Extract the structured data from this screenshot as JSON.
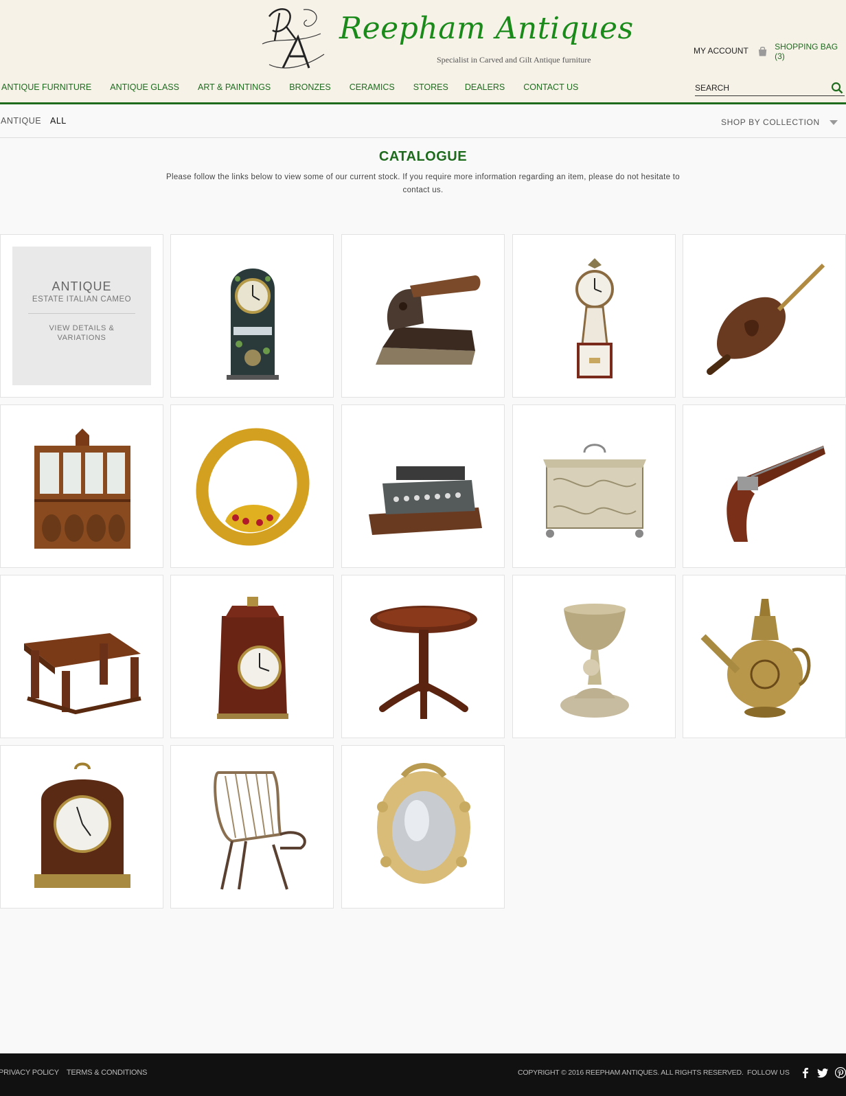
{
  "header": {
    "logo_title": "Reepham Antiques",
    "logo_tagline": "Specialist in Carved and Gilt Antique furniture",
    "my_account": "MY ACCOUNT",
    "shopping_bag": "SHOPPING BAG (3)",
    "nav": [
      "ANTIQUE FURNITURE",
      "ANTIQUE GLASS",
      "ART & PAINTINGS",
      "BRONZES",
      "CERAMICS",
      "STORES",
      "DEALERS",
      "CONTACT US"
    ],
    "search_placeholder": "SEARCH"
  },
  "subbar": {
    "breadcrumb": "ANTIQUE",
    "filter_all": "ALL",
    "shop_by_collection": "SHOP BY COLLECTION"
  },
  "catalogue": {
    "title": "CATALOGUE",
    "description": "Please follow the links below to view some of our current stock. If you require more information regarding an item, please do not hesitate to contact us."
  },
  "featured": {
    "title": "ANTIQUE",
    "subtitle": "ESTATE ITALIAN CAMEO",
    "link": "VIEW DETAILS & VARIATIONS"
  },
  "products": [
    "mantel-clock",
    "carved-iron",
    "banjo-clock",
    "carved-bellows",
    "breakfront-bookcase",
    "gold-bangle",
    "typewriter",
    "silver-tea-caddy",
    "flintlock-pistol",
    "carved-table",
    "bracket-clock",
    "tilt-top-table",
    "silver-cherub-chalice",
    "brass-ewer",
    "mahogany-bracket-clock",
    "rattan-chair",
    "gilt-oval-mirror"
  ],
  "footer": {
    "privacy": "PRIVACY POLICY",
    "terms": "TERMS & CONDITIONS",
    "copyright": "COPYRIGHT © 2016 REEPHAM ANTIQUES. ALL RIGHTS RESERVED.",
    "follow": "FOLLOW US",
    "social": [
      "facebook-icon",
      "twitter-icon",
      "pinterest-icon"
    ]
  },
  "colors": {
    "accent": "#1e6b1e",
    "header_bg": "#f6f2e8",
    "footer_bg": "#111111"
  }
}
